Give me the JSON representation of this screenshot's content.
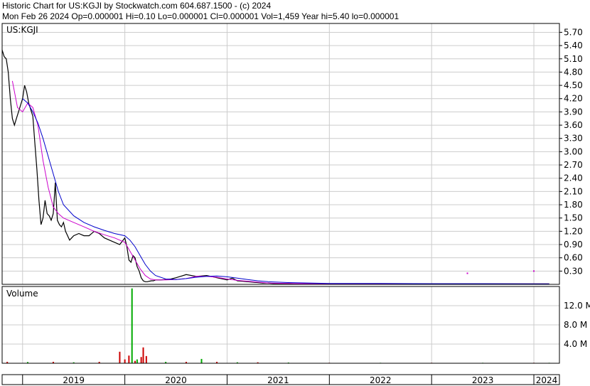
{
  "header": {
    "title": "Historic Chart for US:KGJI by Stockwatch.com 604.687.1500 - (c) 2024",
    "summary": "Mon Feb 26 2024   Op=0.000001   Hi=0.10   Lo=0.000001   Cl=0.000001   Vol=1,459   Year hi=5.40   lo=0.000001"
  },
  "chart_data": [
    {
      "type": "line",
      "title": "US:KGJI",
      "price_axis": {
        "ylim": [
          0,
          5.9
        ],
        "ticks": [
          "5.70",
          "5.40",
          "5.10",
          "4.80",
          "4.50",
          "4.20",
          "3.90",
          "3.60",
          "3.30",
          "3.00",
          "2.70",
          "2.40",
          "2.10",
          "1.80",
          "1.50",
          "1.20",
          "0.90",
          "0.60",
          "0.30"
        ]
      },
      "x_axis": {
        "xlim": [
          2018.8,
          2024.25
        ],
        "ticks": [
          "2019",
          "2020",
          "2021",
          "2022",
          "2023",
          "2024"
        ]
      },
      "grid": true,
      "colors": {
        "price": "#000000",
        "ma_short": "#cc00cc",
        "ma_long": "#0000cc"
      },
      "series": [
        {
          "role": "price",
          "x": [
            2018.8,
            2018.82,
            2018.84,
            2018.86,
            2018.88,
            2018.9,
            2018.92,
            2018.94,
            2018.96,
            2018.98,
            2019.0,
            2019.02,
            2019.04,
            2019.06,
            2019.08,
            2019.1,
            2019.12,
            2019.14,
            2019.16,
            2019.18,
            2019.2,
            2019.22,
            2019.24,
            2019.26,
            2019.28,
            2019.3,
            2019.32,
            2019.34,
            2019.36,
            2019.38,
            2019.4,
            2019.42,
            2019.44,
            2019.46,
            2019.48,
            2019.5,
            2019.55,
            2019.6,
            2019.65,
            2019.7,
            2019.75,
            2019.8,
            2019.85,
            2019.9,
            2019.95,
            2020.0,
            2020.02,
            2020.04,
            2020.06,
            2020.08,
            2020.1,
            2020.12,
            2020.14,
            2020.16,
            2020.18,
            2020.2,
            2020.22,
            2020.24,
            2020.26,
            2020.28,
            2020.3,
            2020.35,
            2020.4,
            2020.45,
            2020.5,
            2020.6,
            2020.7,
            2020.8,
            2020.9,
            2021.0,
            2021.05,
            2021.1,
            2021.15,
            2021.2,
            2021.25,
            2021.3,
            2021.35,
            2021.4,
            2021.45,
            2021.5,
            2021.6,
            2021.7,
            2021.8,
            2021.9,
            2022.0,
            2022.2,
            2022.4,
            2022.6,
            2022.8,
            2023.0,
            2023.2,
            2023.4,
            2023.6,
            2023.8,
            2024.0,
            2024.1,
            2024.15
          ],
          "values": [
            5.3,
            5.15,
            5.1,
            4.8,
            4.2,
            3.75,
            3.6,
            3.75,
            3.9,
            4.05,
            4.2,
            4.5,
            4.35,
            4.1,
            3.95,
            3.8,
            3.2,
            2.6,
            1.9,
            1.35,
            1.5,
            1.9,
            1.6,
            1.55,
            1.45,
            1.6,
            2.3,
            1.45,
            1.35,
            1.3,
            1.4,
            1.2,
            1.1,
            1.0,
            1.05,
            1.1,
            1.15,
            1.1,
            1.1,
            1.2,
            1.15,
            1.05,
            1.0,
            0.95,
            0.9,
            1.05,
            0.85,
            0.55,
            0.5,
            0.65,
            0.6,
            0.4,
            0.3,
            0.15,
            0.08,
            0.06,
            0.06,
            0.07,
            0.08,
            0.08,
            0.1,
            0.1,
            0.11,
            0.12,
            0.15,
            0.22,
            0.18,
            0.2,
            0.15,
            0.1,
            0.14,
            0.08,
            0.07,
            0.06,
            0.05,
            0.04,
            0.03,
            0.03,
            0.02,
            0.02,
            0.02,
            0.01,
            0.01,
            0.01,
            0.01,
            0.01,
            0.01,
            0.01,
            0.01,
            0.01,
            0.01,
            0.01,
            0.01,
            0.01,
            0.01,
            0.01,
            0.01
          ]
        },
        {
          "role": "ma_short",
          "x": [
            2018.9,
            2018.95,
            2019.0,
            2019.05,
            2019.1,
            2019.15,
            2019.2,
            2019.25,
            2019.3,
            2019.35,
            2019.4,
            2019.5,
            2019.6,
            2019.7,
            2019.8,
            2019.9,
            2020.0,
            2020.05,
            2020.1,
            2020.15,
            2020.2,
            2020.25,
            2020.3,
            2020.4,
            2020.5,
            2020.6,
            2020.7,
            2020.8,
            2020.9,
            2021.0,
            2021.1,
            2021.2,
            2021.3,
            2021.4,
            2021.6,
            2021.8,
            2022.0,
            2022.5,
            2023.0,
            2023.5,
            2024.0,
            2024.15
          ],
          "values": [
            4.6,
            4.0,
            3.9,
            4.1,
            4.0,
            3.6,
            2.8,
            2.2,
            1.75,
            1.6,
            1.5,
            1.4,
            1.3,
            1.2,
            1.12,
            1.05,
            0.95,
            0.75,
            0.55,
            0.35,
            0.2,
            0.12,
            0.1,
            0.1,
            0.11,
            0.13,
            0.18,
            0.18,
            0.16,
            0.12,
            0.09,
            0.07,
            0.05,
            0.03,
            0.02,
            0.015,
            0.01,
            0.01,
            0.01,
            0.01,
            0.01,
            0.01
          ]
        },
        {
          "role": "ma_long",
          "x": [
            2019.0,
            2019.05,
            2019.1,
            2019.15,
            2019.2,
            2019.25,
            2019.3,
            2019.35,
            2019.4,
            2019.5,
            2019.6,
            2019.7,
            2019.8,
            2019.9,
            2020.0,
            2020.05,
            2020.1,
            2020.15,
            2020.2,
            2020.25,
            2020.3,
            2020.4,
            2020.5,
            2020.6,
            2020.7,
            2020.8,
            2020.9,
            2021.0,
            2021.1,
            2021.2,
            2021.3,
            2021.4,
            2021.6,
            2021.8,
            2022.0,
            2022.5,
            2023.0,
            2023.5,
            2024.0,
            2024.15
          ],
          "values": [
            4.2,
            4.1,
            3.9,
            3.65,
            3.3,
            2.9,
            2.5,
            2.1,
            1.8,
            1.55,
            1.4,
            1.3,
            1.22,
            1.15,
            1.1,
            1.0,
            0.85,
            0.65,
            0.45,
            0.3,
            0.2,
            0.12,
            0.11,
            0.13,
            0.16,
            0.18,
            0.19,
            0.17,
            0.14,
            0.11,
            0.08,
            0.06,
            0.04,
            0.03,
            0.02,
            0.02,
            0.015,
            0.015,
            0.01,
            0.01
          ]
        }
      ],
      "markers": [
        {
          "x": 2023.35,
          "value": 0.25
        },
        {
          "x": 2024.0,
          "value": 0.3
        }
      ]
    },
    {
      "type": "bar",
      "title": "Volume",
      "ylim": [
        0,
        16
      ],
      "ticks": [
        "12.0 M",
        "8.0 M",
        "4.0 M"
      ],
      "colors": {
        "up": "#00aa00",
        "down": "#cc0000"
      },
      "bars": [
        {
          "x": 2018.85,
          "value": 0.3,
          "dir": "down"
        },
        {
          "x": 2019.05,
          "value": 0.25,
          "dir": "up"
        },
        {
          "x": 2019.3,
          "value": 0.3,
          "dir": "down"
        },
        {
          "x": 2019.5,
          "value": 0.2,
          "dir": "up"
        },
        {
          "x": 2019.75,
          "value": 0.3,
          "dir": "down"
        },
        {
          "x": 2019.95,
          "value": 2.4,
          "dir": "down"
        },
        {
          "x": 2020.0,
          "value": 0.8,
          "dir": "down"
        },
        {
          "x": 2020.04,
          "value": 1.6,
          "dir": "down"
        },
        {
          "x": 2020.07,
          "value": 15.6,
          "dir": "up"
        },
        {
          "x": 2020.1,
          "value": 0.5,
          "dir": "down"
        },
        {
          "x": 2020.12,
          "value": 0.8,
          "dir": "up"
        },
        {
          "x": 2020.16,
          "value": 1.3,
          "dir": "down"
        },
        {
          "x": 2020.18,
          "value": 3.3,
          "dir": "down"
        },
        {
          "x": 2020.21,
          "value": 1.5,
          "dir": "down"
        },
        {
          "x": 2020.4,
          "value": 0.3,
          "dir": "up"
        },
        {
          "x": 2020.6,
          "value": 0.3,
          "dir": "down"
        },
        {
          "x": 2020.75,
          "value": 0.9,
          "dir": "up"
        },
        {
          "x": 2020.9,
          "value": 0.3,
          "dir": "down"
        },
        {
          "x": 2021.1,
          "value": 0.2,
          "dir": "up"
        },
        {
          "x": 2021.3,
          "value": 0.2,
          "dir": "down"
        },
        {
          "x": 2021.6,
          "value": 0.15,
          "dir": "up"
        },
        {
          "x": 2022.0,
          "value": 0.1,
          "dir": "down"
        },
        {
          "x": 2022.5,
          "value": 0.1,
          "dir": "up"
        },
        {
          "x": 2023.0,
          "value": 0.1,
          "dir": "down"
        },
        {
          "x": 2023.5,
          "value": 0.1,
          "dir": "up"
        },
        {
          "x": 2024.0,
          "value": 0.1,
          "dir": "down"
        },
        {
          "x": 2024.15,
          "value": 0.1,
          "dir": "up"
        }
      ]
    }
  ]
}
